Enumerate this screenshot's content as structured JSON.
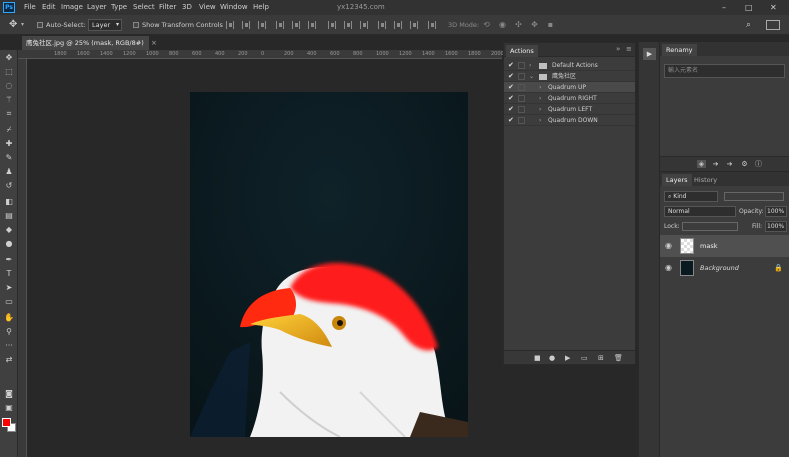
{
  "app": {
    "logo": "Ps",
    "watermark": "yx12345.com"
  },
  "menu": [
    "File",
    "Edit",
    "Image",
    "Layer",
    "Type",
    "Select",
    "Filter",
    "3D",
    "View",
    "Window",
    "Help"
  ],
  "window_controls": {
    "minimize": "–",
    "maximize": "□",
    "close": "✕"
  },
  "options_bar": {
    "auto_select_label": "Auto-Select:",
    "auto_select_value": "Layer",
    "show_transform_label": "Show Transform Controls",
    "mode_label": "3D Mode:"
  },
  "document": {
    "tab_title": "鹰兔社区.jpg @ 25% (mask, RGB/8#) *",
    "close": "×"
  },
  "ruler": {
    "ticks": [
      "1800",
      "1600",
      "1400",
      "1200",
      "1000",
      "800",
      "600",
      "400",
      "200",
      "0",
      "200",
      "400",
      "600",
      "800",
      "1000",
      "1200",
      "1400",
      "1600",
      "1800",
      "2000",
      "2200"
    ]
  },
  "colors": {
    "foreground": "#ff0000",
    "background": "#ffffff",
    "accent": "#31a8ff"
  },
  "actions_panel": {
    "tab": "Actions",
    "rows": [
      {
        "label": "Default Actions",
        "type": "set",
        "checked": true
      },
      {
        "label": "鹰兔社区",
        "type": "set",
        "checked": true
      },
      {
        "label": "Quadrum UP",
        "type": "action",
        "checked": true,
        "selected": true
      },
      {
        "label": "Quadrum RIGHT",
        "type": "action",
        "checked": true
      },
      {
        "label": "Quadrum LEFT",
        "type": "action",
        "checked": true
      },
      {
        "label": "Quadrum DOWN",
        "type": "action",
        "checked": true
      }
    ],
    "footer_icons": [
      "stop-icon",
      "record-icon",
      "play-icon",
      "new-set-icon",
      "new-action-icon",
      "trash-icon"
    ]
  },
  "renamy_panel": {
    "tab": "Renamy",
    "placeholder": "輸入元素名"
  },
  "layers_panel": {
    "tabs": [
      "Layers",
      "History"
    ],
    "filter_kind": "Kind",
    "blend_mode": "Normal",
    "opacity_label": "Opacity:",
    "opacity_value": "100%",
    "lock_label": "Lock:",
    "fill_label": "Fill:",
    "fill_value": "100%",
    "layers": [
      {
        "name": "mask",
        "visible": true,
        "selected": true
      },
      {
        "name": "Background",
        "visible": true,
        "locked": true
      }
    ]
  }
}
